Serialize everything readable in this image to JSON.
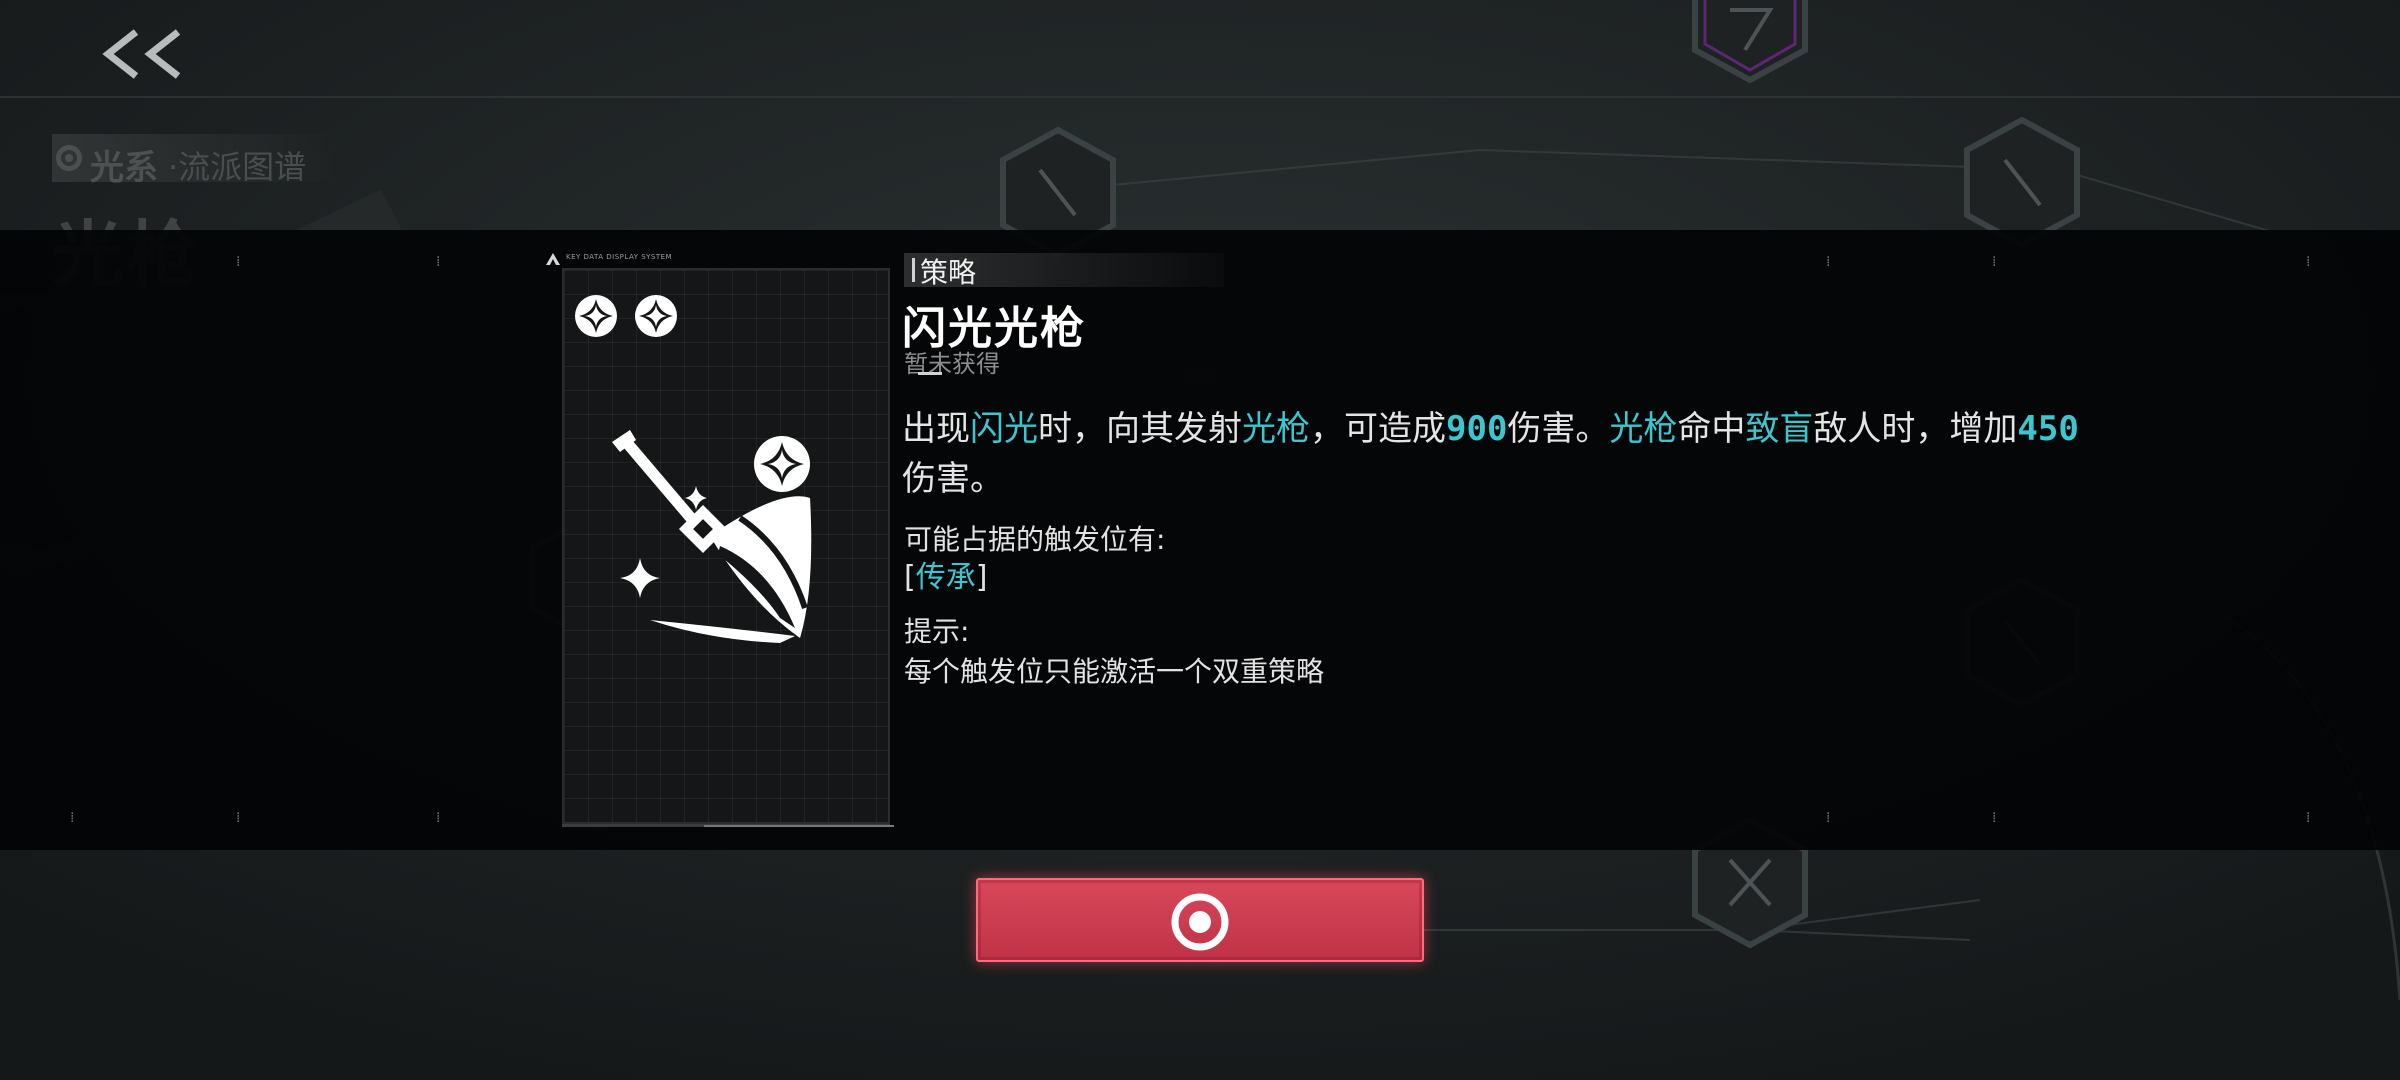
{
  "header": {
    "back_icon": "double-chevron-left-icon",
    "breadcrumb_main": "光系",
    "breadcrumb_sub": "·流派图谱",
    "page_title": "光枪"
  },
  "card": {
    "caption": "KEY DATA DISPLAY SYSTEM",
    "rank_icon": "four-point-star-icon",
    "rank_count": 2,
    "art_icon": "light-spear-icon"
  },
  "detail": {
    "tag": "策略",
    "name": "闪光光枪",
    "status": "暂未获得",
    "desc": {
      "p1": "出现",
      "h1": "闪光",
      "p2": "时，向其发射",
      "h2": "光枪",
      "p3": "，可造成",
      "n1": "900",
      "p4": "伤害。",
      "h3": "光枪",
      "p5": "命中",
      "h4": "致盲",
      "p6": "敌人时，增加",
      "n2": "450",
      "p7": "伤害。"
    },
    "slot_label": "可能占据的触发位有:",
    "slot_open": "[",
    "slot_name": "传承",
    "slot_close": "]",
    "tip_label": "提示:",
    "tip_text": "每个触发位只能激活一个双重策略"
  },
  "confirm": {
    "icon": "ring-target-icon"
  },
  "colors": {
    "accent": "#3dc6cf",
    "confirm": "#c93a4f",
    "modal_bg": "#030405"
  }
}
